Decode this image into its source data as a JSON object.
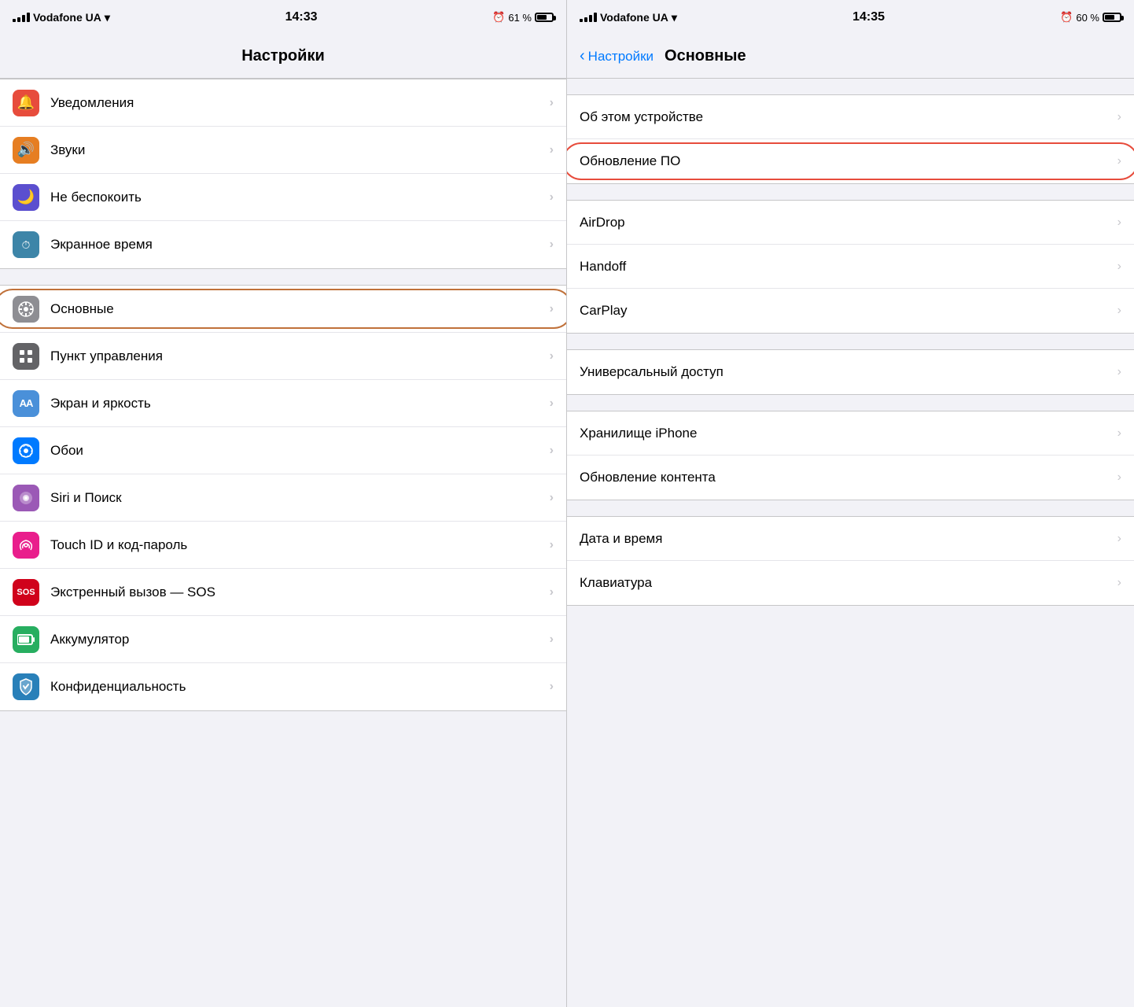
{
  "left": {
    "statusBar": {
      "carrier": "Vodafone UA",
      "time": "14:33",
      "battery": "61 %"
    },
    "title": "Настройки",
    "groups": [
      {
        "id": "group1",
        "items": [
          {
            "id": "notifications",
            "icon": "🔔",
            "iconBg": "icon-red",
            "label": "Уведомления"
          },
          {
            "id": "sounds",
            "icon": "🔊",
            "iconBg": "icon-orange",
            "label": "Звуки"
          },
          {
            "id": "donotdisturb",
            "icon": "🌙",
            "iconBg": "icon-purple-dark",
            "label": "Не беспокоить"
          },
          {
            "id": "screentime",
            "icon": "⏱",
            "iconBg": "icon-teal",
            "label": "Экранное время"
          }
        ]
      },
      {
        "id": "group2",
        "items": [
          {
            "id": "general",
            "icon": "⚙️",
            "iconBg": "icon-gray",
            "label": "Основные",
            "highlighted": true
          },
          {
            "id": "control",
            "icon": "⚙",
            "iconBg": "icon-gray2",
            "label": "Пункт управления"
          },
          {
            "id": "display",
            "icon": "AA",
            "iconBg": "icon-blue",
            "label": "Экран и яркость"
          },
          {
            "id": "wallpaper",
            "icon": "✿",
            "iconBg": "icon-blue2",
            "label": "Обои"
          },
          {
            "id": "siri",
            "icon": "◎",
            "iconBg": "icon-purple",
            "label": "Siri и Поиск"
          },
          {
            "id": "touchid",
            "icon": "☉",
            "iconBg": "icon-pink",
            "label": "Touch ID и код-пароль"
          },
          {
            "id": "sos",
            "icon": "SOS",
            "iconBg": "icon-red2",
            "label": "Экстренный вызов — SOS",
            "textIcon": true
          },
          {
            "id": "battery",
            "icon": "🔋",
            "iconBg": "icon-green",
            "label": "Аккумулятор"
          },
          {
            "id": "privacy",
            "icon": "✋",
            "iconBg": "icon-blue3",
            "label": "Конфиденциальность"
          }
        ]
      }
    ]
  },
  "right": {
    "statusBar": {
      "carrier": "Vodafone UA",
      "time": "14:35",
      "battery": "60 %"
    },
    "backLabel": "Настройки",
    "title": "Основные",
    "groups": [
      {
        "id": "rg1",
        "items": [
          {
            "id": "aboutdevice",
            "label": "Об этом устройстве"
          },
          {
            "id": "softwareupdate",
            "label": "Обновление ПО",
            "highlighted": true
          }
        ]
      },
      {
        "id": "rg2",
        "items": [
          {
            "id": "airdrop",
            "label": "AirDrop"
          },
          {
            "id": "handoff",
            "label": "Handoff"
          },
          {
            "id": "carplay",
            "label": "CarPlay"
          }
        ]
      },
      {
        "id": "rg3",
        "items": [
          {
            "id": "accessibility",
            "label": "Универсальный доступ"
          }
        ]
      },
      {
        "id": "rg4",
        "items": [
          {
            "id": "iphonestg",
            "label": "Хранилище iPhone"
          },
          {
            "id": "bgrefresh",
            "label": "Обновление контента"
          }
        ]
      },
      {
        "id": "rg5",
        "items": [
          {
            "id": "datetime",
            "label": "Дата и время"
          },
          {
            "id": "keyboard",
            "label": "Клавиатура"
          }
        ]
      }
    ]
  }
}
